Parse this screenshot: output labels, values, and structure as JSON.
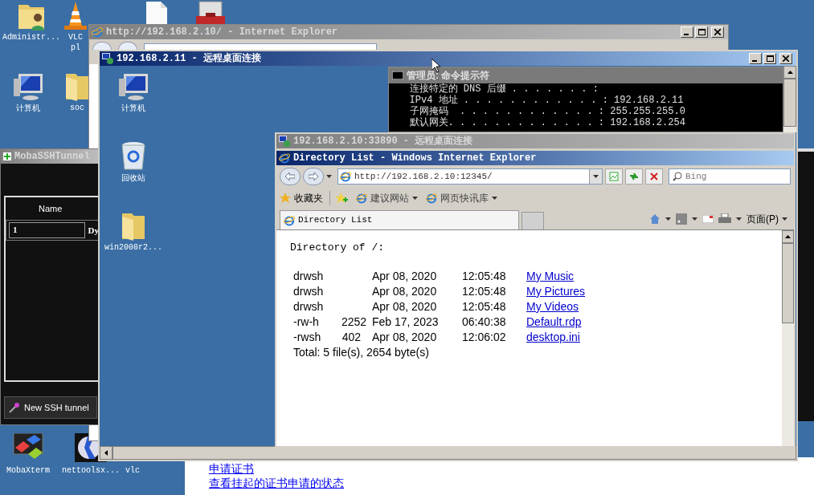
{
  "desktop_icons": [
    {
      "kind": "user-folder",
      "lines": [
        "Administr..."
      ]
    },
    {
      "kind": "cone",
      "lines": [
        "VLC",
        "pl"
      ]
    },
    {
      "kind": "document"
    },
    {
      "kind": "toolbox"
    },
    {
      "kind": "computer",
      "lines": [
        "计算机"
      ]
    },
    {
      "kind": "folder",
      "lines": [
        "soc"
      ]
    },
    {
      "kind": "blocks",
      "lines": [
        "MobaXterm"
      ]
    },
    {
      "kind": "cross",
      "lines": [
        "nettoolsx..."
      ]
    },
    {
      "lines": [
        "vlc"
      ]
    }
  ],
  "browser_behind": {
    "title": "http://192.168.2.10/ - Internet Explorer",
    "active": false
  },
  "ssh_tunnel": {
    "title": "MobaSSHTunnel",
    "active": false,
    "column": "Name",
    "cells": [
      "1",
      "Dy"
    ],
    "button": "New SSH tunnel"
  },
  "web_page_behind": {
    "links": [
      "申请证书",
      "查看挂起的证书申请的状态"
    ]
  },
  "remote_desktop": {
    "title": "192.168.2.11 - 远程桌面连接",
    "active": true,
    "icons": [
      {
        "kind": "computer",
        "lines": [
          "计算机"
        ]
      },
      {
        "kind": "recycle-bin",
        "lines": [
          "回收站"
        ]
      },
      {
        "kind": "folder",
        "lines": [
          "win2008r2..."
        ]
      }
    ],
    "console": {
      "title": "管理员: 命令提示符",
      "active": false,
      "lines": [
        "   连接特定的 DNS 后缀 . . . . . . . :",
        "   IPv4 地址 . . . . . . . . . . . . : 192.168.2.11",
        "   子网掩码  . . . . . . . . . . . . : 255.255.255.0",
        "   默认网关. . . . . . . . . . . . . : 192.168.2.254"
      ]
    },
    "inner_remote": {
      "title": "192.168.2.10:33890 - 远程桌面连接",
      "active": false,
      "browser": {
        "title": "Directory List - Windows Internet Explorer",
        "active": true,
        "address": "http://192.168.2.10:12345/",
        "search_placeholder": "Bing",
        "favorites": "收藏夹",
        "feeds": [
          "建议网站",
          "网页快讯库"
        ],
        "tab": "Directory List",
        "page_menu": "页面(P)",
        "heading": "Directory of /:",
        "rows": [
          {
            "attributes": "drwsh",
            "date": "Apr 08, 2020",
            "time": "12:05:48",
            "name": "My Music"
          },
          {
            "attributes": "drwsh",
            "date": "Apr 08, 2020",
            "time": "12:05:48",
            "name": "My Pictures"
          },
          {
            "attributes": "drwsh",
            "date": "Apr 08, 2020",
            "time": "12:05:48",
            "name": "My Videos"
          },
          {
            "attributes": "-rw-h",
            "size": "2252",
            "date": "Feb 17, 2023",
            "time": "06:40:38",
            "name": "Default.rdp"
          },
          {
            "attributes": "-rwsh",
            "size": "402",
            "date": "Apr 08, 2020",
            "time": "12:06:02",
            "name": "desktop.ini"
          }
        ],
        "total": "Total: 5 file(s), 2654 byte(s)"
      }
    }
  }
}
